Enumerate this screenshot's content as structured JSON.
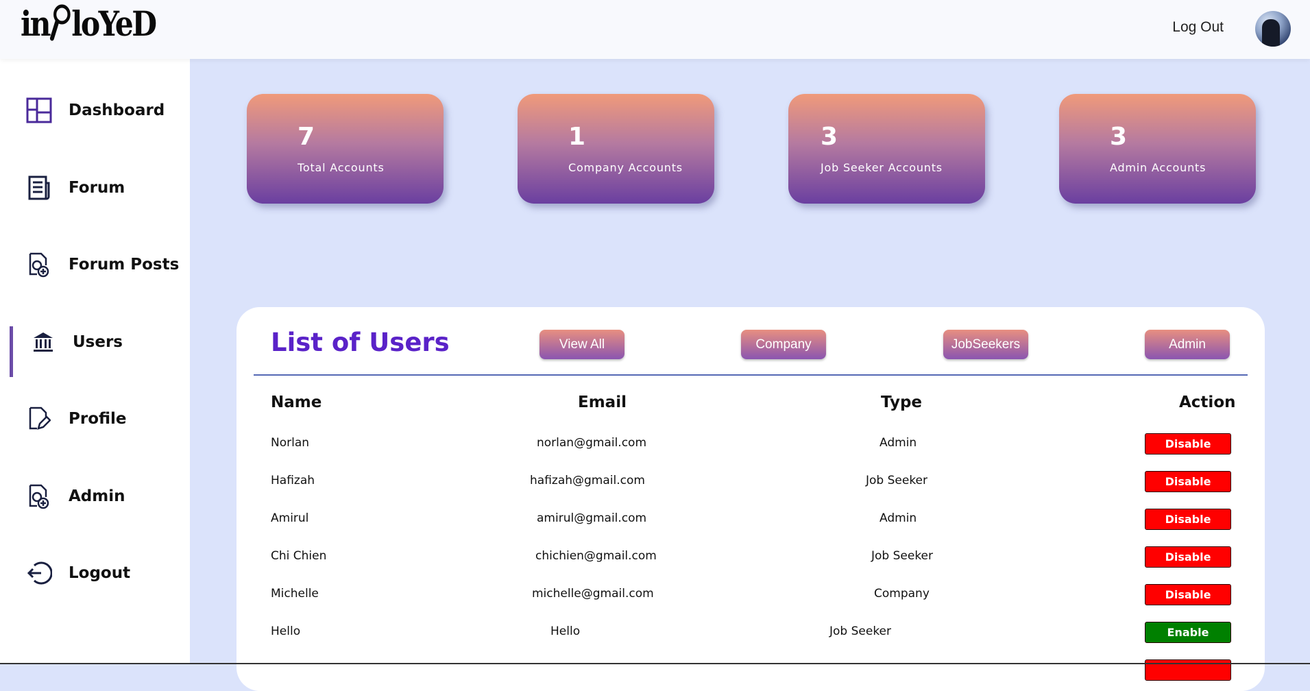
{
  "header": {
    "logo_text": "inPloYeD",
    "logout_label": "Log Out"
  },
  "sidebar": {
    "items": [
      {
        "label": "Dashboard",
        "icon": "dashboard-grid-icon"
      },
      {
        "label": "Forum",
        "icon": "newspaper-icon"
      },
      {
        "label": "Forum Posts",
        "icon": "document-add-icon"
      },
      {
        "label": "Users",
        "icon": "bank-building-icon",
        "active": true
      },
      {
        "label": "Profile",
        "icon": "document-edit-icon"
      },
      {
        "label": "Admin",
        "icon": "document-add-icon"
      },
      {
        "label": "Logout",
        "icon": "logout-icon"
      }
    ]
  },
  "stats": [
    {
      "value": "7",
      "label": "Total Accounts"
    },
    {
      "value": "1",
      "label": "Company Accounts"
    },
    {
      "value": "3",
      "label": "Job Seeker Accounts"
    },
    {
      "value": "3",
      "label": "Admin Accounts"
    }
  ],
  "users_panel": {
    "title": "List of Users",
    "filters": [
      "View All",
      "Company",
      "JobSeekers",
      "Admin"
    ],
    "columns": [
      "Name",
      "Email",
      "Type",
      "Action"
    ],
    "rows": [
      {
        "name": "Norlan",
        "email": "norlan@gmail.com",
        "type": "Admin",
        "action": "Disable"
      },
      {
        "name": "Hafizah",
        "email": "hafizah@gmail.com",
        "type": "Job Seeker",
        "action": "Disable"
      },
      {
        "name": "Amirul",
        "email": "amirul@gmail.com",
        "type": "Admin",
        "action": "Disable"
      },
      {
        "name": "Chi Chien",
        "email": "chichien@gmail.com",
        "type": "Job Seeker",
        "action": "Disable"
      },
      {
        "name": "Michelle",
        "email": "michelle@gmail.com",
        "type": "Company",
        "action": "Disable"
      },
      {
        "name": "Hello",
        "email": "Hello",
        "type": "Job Seeker",
        "action": "Enable"
      }
    ]
  },
  "colors": {
    "background": "#dbe3fb",
    "title_purple": "#5a22c8",
    "disable_red": "#ff0000",
    "enable_green": "#008000",
    "active_indicator": "#6b4ca8"
  }
}
